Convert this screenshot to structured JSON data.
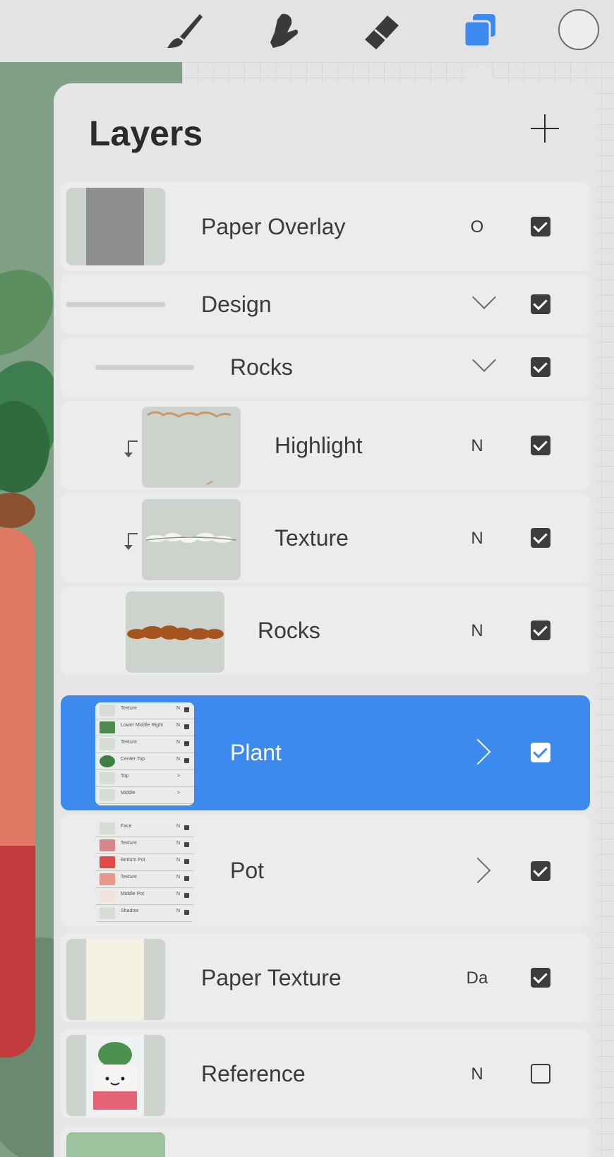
{
  "panel": {
    "title": "Layers"
  },
  "layers": [
    {
      "name": "Paper Overlay",
      "blend": "O",
      "visible": true
    },
    {
      "name": "Design",
      "type": "group",
      "visible": true
    },
    {
      "name": "Rocks",
      "type": "group",
      "visible": true
    },
    {
      "name": "Highlight",
      "blend": "N",
      "clipped": true,
      "visible": true
    },
    {
      "name": "Texture",
      "blend": "N",
      "clipped": true,
      "visible": true
    },
    {
      "name": "Rocks",
      "blend": "N",
      "visible": true
    },
    {
      "name": "Plant",
      "type": "group",
      "selected": true,
      "visible": true
    },
    {
      "name": "Pot",
      "type": "group",
      "visible": true
    },
    {
      "name": "Paper Texture",
      "blend": "Da",
      "visible": true
    },
    {
      "name": "Reference",
      "blend": "N",
      "visible": false
    }
  ],
  "plant_preview": [
    {
      "name": "Texture",
      "blend": "N"
    },
    {
      "name": "Lower Middle Right",
      "blend": "N"
    },
    {
      "name": "Texture",
      "blend": "N"
    },
    {
      "name": "Center Top",
      "blend": "N"
    },
    {
      "name": "Top",
      "blend": ">"
    },
    {
      "name": "Middle",
      "blend": ">"
    }
  ],
  "pot_preview": [
    {
      "name": "Face",
      "blend": "N"
    },
    {
      "name": "Texture",
      "blend": "N"
    },
    {
      "name": "Bottom Pot",
      "blend": "N"
    },
    {
      "name": "Texture",
      "blend": "N"
    },
    {
      "name": "Middle Pot",
      "blend": "N"
    },
    {
      "name": "Shadow",
      "blend": "N"
    }
  ],
  "icons": [
    "brush-icon",
    "smudge-icon",
    "eraser-icon",
    "layers-icon",
    "color-well"
  ],
  "colors": {
    "accent": "#3d8aef",
    "panel": "#e5e6e5",
    "row": "#ececec"
  }
}
